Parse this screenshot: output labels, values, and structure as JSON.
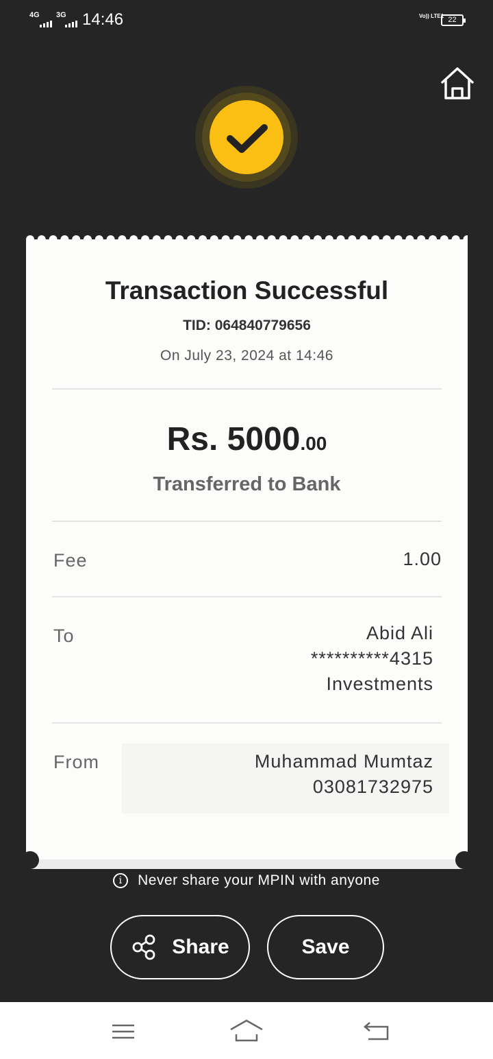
{
  "status_bar": {
    "sim1_network": "4G",
    "sim2_network": "3G",
    "time": "14:46",
    "volte_label": "Vo)) LTE1",
    "battery_level": "22"
  },
  "icons": {
    "home": "home-icon",
    "success": "checkmark-icon",
    "info": "info-icon",
    "share": "share-icon",
    "menu": "menu-icon",
    "nav_home": "nav-home-icon",
    "back": "back-icon"
  },
  "colors": {
    "background": "#242524",
    "accent": "#fbbe13",
    "receipt": "#fcfcfb"
  },
  "receipt": {
    "title": "Transaction Successful",
    "tid": "TID: 064840779656",
    "date": "On July 23, 2024 at 14:46",
    "amount_main": "Rs. 5000",
    "amount_cents": ".00",
    "amount_desc": "Transferred to Bank",
    "fee": {
      "label": "Fee",
      "value": "1.00"
    },
    "to": {
      "label": "To",
      "name": "Abid Ali",
      "account": "**********4315",
      "bank": "Investments"
    },
    "from": {
      "label": "From",
      "name": "Muhammad Mumtaz",
      "number": "03081732975"
    }
  },
  "notice": "Never share your MPIN with anyone",
  "buttons": {
    "share": "Share",
    "save": "Save"
  }
}
